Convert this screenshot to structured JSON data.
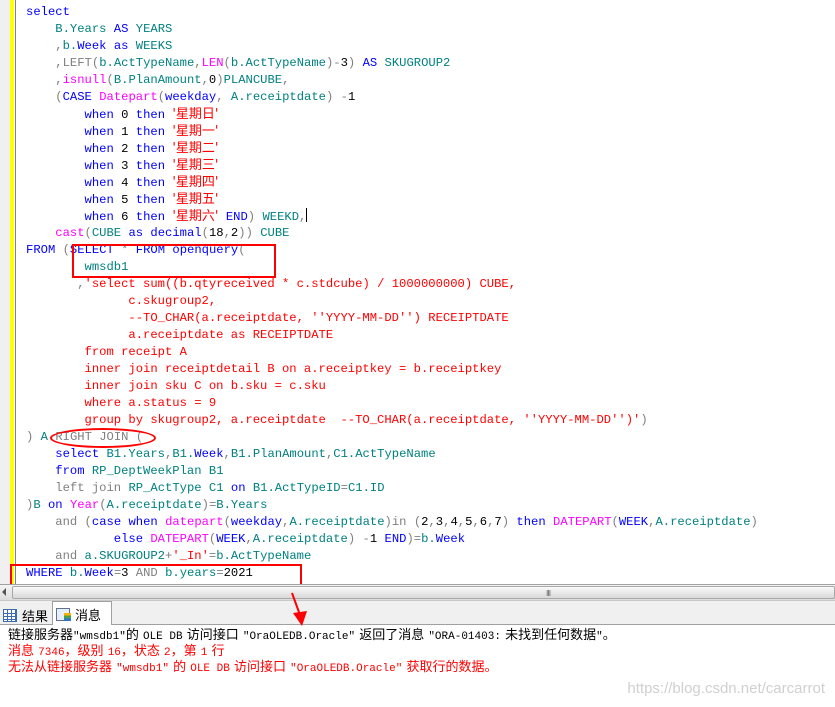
{
  "editor": {
    "language": "T-SQL",
    "lines": [
      [
        {
          "t": "select",
          "c": "kw"
        }
      ],
      [
        {
          "t": "    "
        },
        {
          "t": "B.Years",
          "c": "id"
        },
        {
          "t": " "
        },
        {
          "t": "AS",
          "c": "kw"
        },
        {
          "t": " "
        },
        {
          "t": "YEARS",
          "c": "id"
        }
      ],
      [
        {
          "t": "    "
        },
        {
          "t": ",",
          "c": "op"
        },
        {
          "t": "b.",
          "c": "id"
        },
        {
          "t": "Week",
          "c": "kw"
        },
        {
          "t": " "
        },
        {
          "t": "as",
          "c": "kw"
        },
        {
          "t": " "
        },
        {
          "t": "WEEKS",
          "c": "id"
        }
      ],
      [
        {
          "t": "    "
        },
        {
          "t": ",",
          "c": "op"
        },
        {
          "t": "LEFT",
          "c": "op"
        },
        {
          "t": "(",
          "c": "op"
        },
        {
          "t": "b.ActTypeName",
          "c": "id"
        },
        {
          "t": ",",
          "c": "op"
        },
        {
          "t": "LEN",
          "c": "fn"
        },
        {
          "t": "(",
          "c": "op"
        },
        {
          "t": "b.ActTypeName",
          "c": "id"
        },
        {
          "t": ")-",
          "c": "op"
        },
        {
          "t": "3",
          "c": "num"
        },
        {
          "t": ")",
          "c": "op"
        },
        {
          "t": " "
        },
        {
          "t": "AS",
          "c": "kw"
        },
        {
          "t": " "
        },
        {
          "t": "SKUGROUP2",
          "c": "id"
        }
      ],
      [
        {
          "t": "    "
        },
        {
          "t": ",",
          "c": "op"
        },
        {
          "t": "isnull",
          "c": "fn"
        },
        {
          "t": "(",
          "c": "op"
        },
        {
          "t": "B.PlanAmount",
          "c": "id"
        },
        {
          "t": ",",
          "c": "op"
        },
        {
          "t": "0",
          "c": "num"
        },
        {
          "t": ")",
          "c": "op"
        },
        {
          "t": "PLANCUBE",
          "c": "id"
        },
        {
          "t": ",",
          "c": "op"
        }
      ],
      [
        {
          "t": "    "
        },
        {
          "t": "(",
          "c": "op"
        },
        {
          "t": "CASE",
          "c": "kw"
        },
        {
          "t": " "
        },
        {
          "t": "Datepart",
          "c": "fn"
        },
        {
          "t": "(",
          "c": "op"
        },
        {
          "t": "weekday",
          "c": "kw"
        },
        {
          "t": ",",
          "c": "op"
        },
        {
          "t": " "
        },
        {
          "t": "A.receiptdate",
          "c": "id"
        },
        {
          "t": ")",
          "c": "op"
        },
        {
          "t": " "
        },
        {
          "t": "-",
          "c": "op"
        },
        {
          "t": "1",
          "c": "num"
        }
      ],
      [
        {
          "t": "        "
        },
        {
          "t": "when",
          "c": "kw"
        },
        {
          "t": " "
        },
        {
          "t": "0",
          "c": "num"
        },
        {
          "t": " "
        },
        {
          "t": "then",
          "c": "kw"
        },
        {
          "t": " "
        },
        {
          "t": "'星期日'",
          "c": "str cjk"
        }
      ],
      [
        {
          "t": "        "
        },
        {
          "t": "when",
          "c": "kw"
        },
        {
          "t": " "
        },
        {
          "t": "1",
          "c": "num"
        },
        {
          "t": " "
        },
        {
          "t": "then",
          "c": "kw"
        },
        {
          "t": " "
        },
        {
          "t": "'星期一'",
          "c": "str cjk"
        }
      ],
      [
        {
          "t": "        "
        },
        {
          "t": "when",
          "c": "kw"
        },
        {
          "t": " "
        },
        {
          "t": "2",
          "c": "num"
        },
        {
          "t": " "
        },
        {
          "t": "then",
          "c": "kw"
        },
        {
          "t": " "
        },
        {
          "t": "'星期二'",
          "c": "str cjk"
        }
      ],
      [
        {
          "t": "        "
        },
        {
          "t": "when",
          "c": "kw"
        },
        {
          "t": " "
        },
        {
          "t": "3",
          "c": "num"
        },
        {
          "t": " "
        },
        {
          "t": "then",
          "c": "kw"
        },
        {
          "t": " "
        },
        {
          "t": "'星期三'",
          "c": "str cjk"
        }
      ],
      [
        {
          "t": "        "
        },
        {
          "t": "when",
          "c": "kw"
        },
        {
          "t": " "
        },
        {
          "t": "4",
          "c": "num"
        },
        {
          "t": " "
        },
        {
          "t": "then",
          "c": "kw"
        },
        {
          "t": " "
        },
        {
          "t": "'星期四'",
          "c": "str cjk"
        }
      ],
      [
        {
          "t": "        "
        },
        {
          "t": "when",
          "c": "kw"
        },
        {
          "t": " "
        },
        {
          "t": "5",
          "c": "num"
        },
        {
          "t": " "
        },
        {
          "t": "then",
          "c": "kw"
        },
        {
          "t": " "
        },
        {
          "t": "'星期五'",
          "c": "str cjk"
        }
      ],
      [
        {
          "t": "        "
        },
        {
          "t": "when",
          "c": "kw"
        },
        {
          "t": " "
        },
        {
          "t": "6",
          "c": "num"
        },
        {
          "t": " "
        },
        {
          "t": "then",
          "c": "kw"
        },
        {
          "t": " "
        },
        {
          "t": "'星期六'",
          "c": "str cjk"
        },
        {
          "t": " "
        },
        {
          "t": "END",
          "c": "kw"
        },
        {
          "t": ")",
          "c": "op"
        },
        {
          "t": " "
        },
        {
          "t": "WEEKD",
          "c": "id"
        },
        {
          "t": ",",
          "c": "op"
        },
        {
          "t": "",
          "caret": true
        }
      ],
      [
        {
          "t": "    "
        },
        {
          "t": "cast",
          "c": "fn"
        },
        {
          "t": "(",
          "c": "op"
        },
        {
          "t": "CUBE",
          "c": "id"
        },
        {
          "t": " "
        },
        {
          "t": "as",
          "c": "kw"
        },
        {
          "t": " "
        },
        {
          "t": "decimal",
          "c": "kw"
        },
        {
          "t": "(",
          "c": "op"
        },
        {
          "t": "18",
          "c": "num"
        },
        {
          "t": ",",
          "c": "op"
        },
        {
          "t": "2",
          "c": "num"
        },
        {
          "t": "))",
          "c": "op"
        },
        {
          "t": " "
        },
        {
          "t": "CUBE",
          "c": "id"
        }
      ],
      [
        {
          "t": "FROM",
          "c": "kw"
        },
        {
          "t": " "
        },
        {
          "t": "(",
          "c": "op"
        },
        {
          "t": "SELECT",
          "c": "kw"
        },
        {
          "t": " "
        },
        {
          "t": "*",
          "c": "op"
        },
        {
          "t": " "
        },
        {
          "t": "FROM",
          "c": "kw"
        },
        {
          "t": " "
        },
        {
          "t": "openquery",
          "c": "kw"
        },
        {
          "t": "(",
          "c": "op"
        }
      ],
      [
        {
          "t": "        "
        },
        {
          "t": "wmsdb1",
          "c": "id"
        }
      ],
      [
        {
          "t": "       "
        },
        {
          "t": ",",
          "c": "op"
        },
        {
          "t": "'select sum((b.qtyreceived * c.stdcube) / 1000000000) CUBE,",
          "c": "str"
        }
      ],
      [
        {
          "t": "              c.skugroup2,",
          "c": "str"
        }
      ],
      [
        {
          "t": "              --TO_CHAR(a.receiptdate, ''YYYY-MM-DD'') RECEIPTDATE",
          "c": "str"
        }
      ],
      [
        {
          "t": "              a.receiptdate as RECEIPTDATE",
          "c": "str"
        }
      ],
      [
        {
          "t": "        from receipt A",
          "c": "str"
        }
      ],
      [
        {
          "t": "        inner join receiptdetail B on a.receiptkey = b.receiptkey",
          "c": "str"
        }
      ],
      [
        {
          "t": "        inner join sku C on b.sku = c.sku",
          "c": "str"
        }
      ],
      [
        {
          "t": "        where a.status = 9",
          "c": "str"
        }
      ],
      [
        {
          "t": "        group by skugroup2, a.receiptdate  --TO_CHAR(a.receiptdate, ''YYYY-MM-DD'')'",
          "c": "str"
        },
        {
          "t": ")",
          "c": "op"
        }
      ],
      [
        {
          "t": ")",
          "c": "op"
        },
        {
          "t": " "
        },
        {
          "t": "A",
          "c": "id"
        },
        {
          "t": " "
        },
        {
          "t": "RIGHT",
          "c": "op"
        },
        {
          "t": " "
        },
        {
          "t": "JOIN",
          "c": "op"
        },
        {
          "t": " "
        },
        {
          "t": "(",
          "c": "op"
        }
      ],
      [
        {
          "t": "    "
        },
        {
          "t": "select",
          "c": "kw"
        },
        {
          "t": " "
        },
        {
          "t": "B1.Years",
          "c": "id"
        },
        {
          "t": ",",
          "c": "op"
        },
        {
          "t": "B1.",
          "c": "id"
        },
        {
          "t": "Week",
          "c": "kw"
        },
        {
          "t": ",",
          "c": "op"
        },
        {
          "t": "B1.PlanAmount",
          "c": "id"
        },
        {
          "t": ",",
          "c": "op"
        },
        {
          "t": "C1.ActTypeName",
          "c": "id"
        }
      ],
      [
        {
          "t": "    "
        },
        {
          "t": "from",
          "c": "kw"
        },
        {
          "t": " "
        },
        {
          "t": "RP_DeptWeekPlan",
          "c": "id"
        },
        {
          "t": " "
        },
        {
          "t": "B1",
          "c": "id"
        }
      ],
      [
        {
          "t": "    "
        },
        {
          "t": "left",
          "c": "op"
        },
        {
          "t": " "
        },
        {
          "t": "join",
          "c": "op"
        },
        {
          "t": " "
        },
        {
          "t": "RP_ActType",
          "c": "id"
        },
        {
          "t": " "
        },
        {
          "t": "C1",
          "c": "id"
        },
        {
          "t": " "
        },
        {
          "t": "on",
          "c": "kw"
        },
        {
          "t": " "
        },
        {
          "t": "B1.ActTypeID",
          "c": "id"
        },
        {
          "t": "=",
          "c": "op"
        },
        {
          "t": "C1.ID",
          "c": "id"
        }
      ],
      [
        {
          "t": ")",
          "c": "op"
        },
        {
          "t": "B",
          "c": "id"
        },
        {
          "t": " "
        },
        {
          "t": "on",
          "c": "kw"
        },
        {
          "t": " "
        },
        {
          "t": "Year",
          "c": "fn"
        },
        {
          "t": "(",
          "c": "op"
        },
        {
          "t": "A.receiptdate",
          "c": "id"
        },
        {
          "t": ")=",
          "c": "op"
        },
        {
          "t": "B.Years",
          "c": "id"
        }
      ],
      [
        {
          "t": "    "
        },
        {
          "t": "and",
          "c": "op"
        },
        {
          "t": " "
        },
        {
          "t": "(",
          "c": "op"
        },
        {
          "t": "case",
          "c": "kw"
        },
        {
          "t": " "
        },
        {
          "t": "when",
          "c": "kw"
        },
        {
          "t": " "
        },
        {
          "t": "datepart",
          "c": "fn"
        },
        {
          "t": "(",
          "c": "op"
        },
        {
          "t": "weekday",
          "c": "kw"
        },
        {
          "t": ",",
          "c": "op"
        },
        {
          "t": "A.receiptdate",
          "c": "id"
        },
        {
          "t": ")",
          "c": "op"
        },
        {
          "t": "in",
          "c": "op"
        },
        {
          "t": " "
        },
        {
          "t": "(",
          "c": "op"
        },
        {
          "t": "2",
          "c": "num"
        },
        {
          "t": ",",
          "c": "op"
        },
        {
          "t": "3",
          "c": "num"
        },
        {
          "t": ",",
          "c": "op"
        },
        {
          "t": "4",
          "c": "num"
        },
        {
          "t": ",",
          "c": "op"
        },
        {
          "t": "5",
          "c": "num"
        },
        {
          "t": ",",
          "c": "op"
        },
        {
          "t": "6",
          "c": "num"
        },
        {
          "t": ",",
          "c": "op"
        },
        {
          "t": "7",
          "c": "num"
        },
        {
          "t": ")",
          "c": "op"
        },
        {
          "t": " "
        },
        {
          "t": "then",
          "c": "kw"
        },
        {
          "t": " "
        },
        {
          "t": "DATEPART",
          "c": "fn"
        },
        {
          "t": "(",
          "c": "op"
        },
        {
          "t": "WEEK",
          "c": "kw"
        },
        {
          "t": ",",
          "c": "op"
        },
        {
          "t": "A.receiptdate",
          "c": "id"
        },
        {
          "t": ")",
          "c": "op"
        }
      ],
      [
        {
          "t": "            "
        },
        {
          "t": "else",
          "c": "kw"
        },
        {
          "t": " "
        },
        {
          "t": "DATEPART",
          "c": "fn"
        },
        {
          "t": "(",
          "c": "op"
        },
        {
          "t": "WEEK",
          "c": "kw"
        },
        {
          "t": ",",
          "c": "op"
        },
        {
          "t": "A.receiptdate",
          "c": "id"
        },
        {
          "t": ")",
          "c": "op"
        },
        {
          "t": " "
        },
        {
          "t": "-",
          "c": "op"
        },
        {
          "t": "1",
          "c": "num"
        },
        {
          "t": " "
        },
        {
          "t": "END",
          "c": "kw"
        },
        {
          "t": ")=",
          "c": "op"
        },
        {
          "t": "b.",
          "c": "id"
        },
        {
          "t": "Week",
          "c": "kw"
        }
      ],
      [
        {
          "t": "    "
        },
        {
          "t": "and",
          "c": "op"
        },
        {
          "t": " "
        },
        {
          "t": "a.SKUGROUP2",
          "c": "id"
        },
        {
          "t": "+",
          "c": "op"
        },
        {
          "t": "'_In'",
          "c": "str"
        },
        {
          "t": "=",
          "c": "op"
        },
        {
          "t": "b.ActTypeName",
          "c": "id"
        }
      ],
      [
        {
          "t": "WHERE",
          "c": "kw"
        },
        {
          "t": " "
        },
        {
          "t": "b.",
          "c": "id"
        },
        {
          "t": "Week",
          "c": "kw"
        },
        {
          "t": "=",
          "c": "op"
        },
        {
          "t": "3",
          "c": "num"
        },
        {
          "t": " "
        },
        {
          "t": "AND",
          "c": "op"
        },
        {
          "t": " "
        },
        {
          "t": "b.years",
          "c": "id"
        },
        {
          "t": "=",
          "c": "op"
        },
        {
          "t": "2021",
          "c": "num"
        }
      ]
    ]
  },
  "scrollbar": {
    "grip_glyph": "III"
  },
  "tabs": [
    {
      "label": "结果",
      "icon": "results-grid-icon",
      "active": false
    },
    {
      "label": "消息",
      "icon": "messages-doc-icon",
      "active": true
    }
  ],
  "messages": {
    "line1": {
      "parts": [
        {
          "t": "链接服务器"
        },
        {
          "t": "\"wmsdb1\"",
          "mono": true
        },
        {
          "t": "的 "
        },
        {
          "t": "OLE DB",
          "mono": true
        },
        {
          "t": " 访问接口 "
        },
        {
          "t": "\"OraOLEDB.Oracle\"",
          "mono": true
        },
        {
          "t": " 返回了消息 "
        },
        {
          "t": "\"ORA-01403:",
          "mono": true
        },
        {
          "t": " 未找到任何数据"
        },
        {
          "t": "\"",
          "mono": true
        },
        {
          "t": "。"
        }
      ]
    },
    "line2": {
      "parts": [
        {
          "t": "消息 "
        },
        {
          "t": "7346",
          "mono": true
        },
        {
          "t": "，级别 "
        },
        {
          "t": "16",
          "mono": true
        },
        {
          "t": "，状态 "
        },
        {
          "t": "2",
          "mono": true
        },
        {
          "t": "，第 "
        },
        {
          "t": "1",
          "mono": true
        },
        {
          "t": " 行"
        }
      ]
    },
    "line3": {
      "parts": [
        {
          "t": "无法从链接服务器 "
        },
        {
          "t": "\"wmsdb1\"",
          "mono": true
        },
        {
          "t": " 的 "
        },
        {
          "t": "OLE DB",
          "mono": true
        },
        {
          "t": " 访问接口 "
        },
        {
          "t": "\"OraOLEDB.Oracle\"",
          "mono": true
        },
        {
          "t": " 获取行的数据。"
        }
      ]
    }
  },
  "watermark": "https://blog.csdn.net/carcarrot",
  "colors": {
    "keyword": "#0000ff",
    "function": "#ff00ff",
    "identifier": "#008080",
    "string": "#ff0000",
    "operator": "#808080",
    "annotation": "#ff0000",
    "change_bar": "#ffff00"
  }
}
